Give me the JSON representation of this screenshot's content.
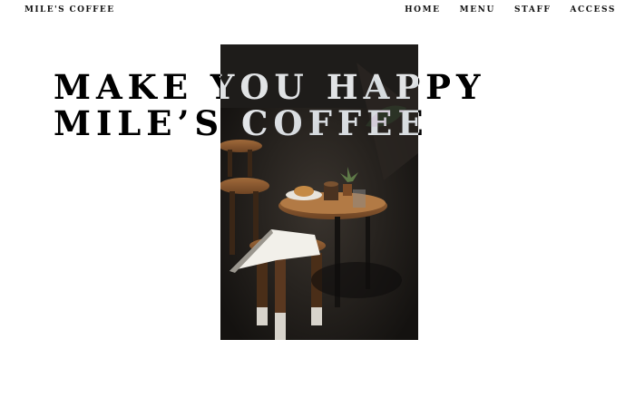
{
  "header": {
    "brand": "MILE'S COFFEE",
    "nav": [
      {
        "label": "HOME"
      },
      {
        "label": "MENU"
      },
      {
        "label": "STAFF"
      },
      {
        "label": "ACCESS"
      }
    ]
  },
  "hero": {
    "line1": "MAKE YOU HAPPY",
    "line2": "MILE’S COFFEE"
  },
  "colors": {
    "text": "#111111",
    "background": "#ffffff",
    "photo_dark": "#1c1a18",
    "wood": "#8a5a32"
  }
}
